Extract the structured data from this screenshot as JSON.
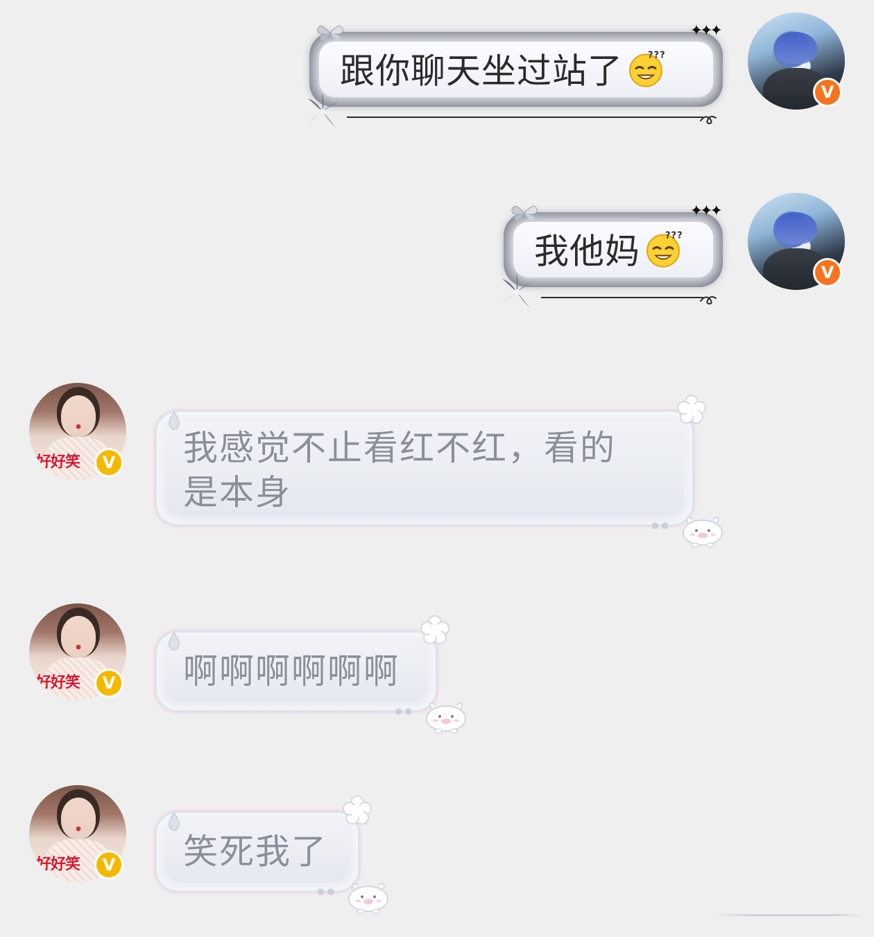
{
  "messages": [
    {
      "side": "right",
      "text": "跟你聊天坐过站了",
      "emoji": "thinking-grin"
    },
    {
      "side": "right",
      "text": "我他妈",
      "emoji": "thinking-grin"
    },
    {
      "side": "left",
      "text_line1": "我感觉不止看红不红，看的",
      "text_line2": "是本身"
    },
    {
      "side": "left",
      "text": "啊啊啊啊啊啊"
    },
    {
      "side": "left",
      "text": "笑死我了"
    }
  ],
  "avatars": {
    "self": {
      "badge": "V",
      "badge_color": "#f7731c"
    },
    "other": {
      "badge": "V",
      "badge_color": "#f5b800",
      "caption": "好好笑"
    }
  },
  "colors": {
    "background": "#efefef",
    "right_text": "#2b2b2b",
    "left_text": "#8a8f9a"
  }
}
